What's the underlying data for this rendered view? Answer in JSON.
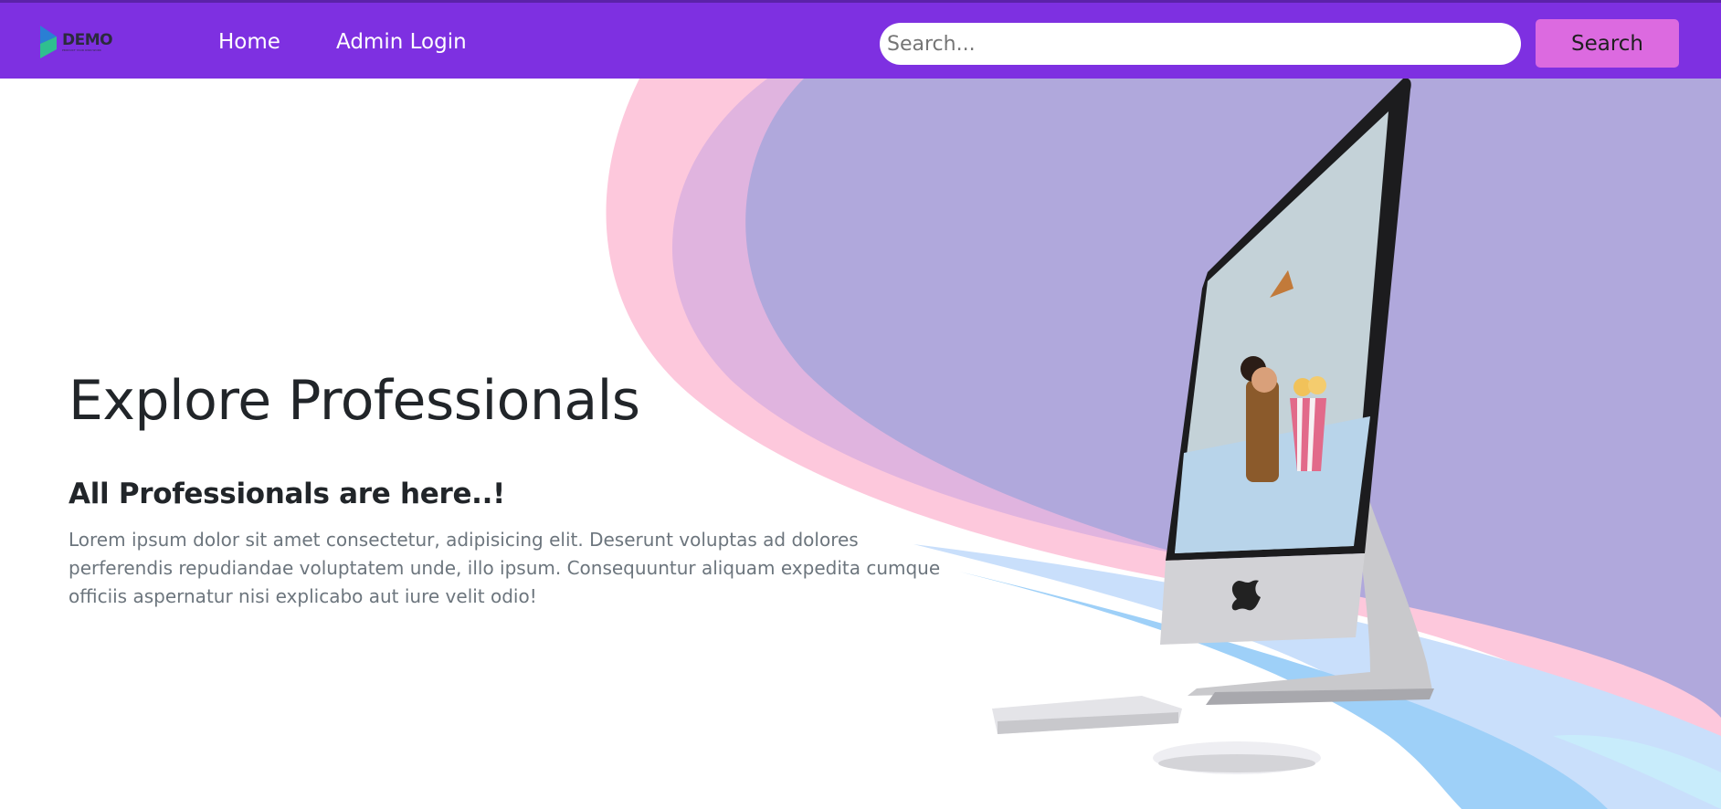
{
  "navbar": {
    "brand": {
      "name": "DEMO",
      "tagline": "PRODUCT YOUR OWN WORK"
    },
    "links": [
      {
        "label": "Home"
      },
      {
        "label": "Admin Login"
      }
    ],
    "search": {
      "placeholder": "Search...",
      "value": "",
      "button_label": "Search"
    },
    "colors": {
      "background": "#7e30e1",
      "search_button": "#dc6ae0"
    }
  },
  "hero": {
    "title": "Explore Professionals",
    "subtitle": "All Professionals are here..!",
    "description": "Lorem ipsum dolor sit amet consectetur, adipisicing elit. Deserunt voluptas ad dolores perferendis repudiandae voluptatem unde, illo ipsum. Consequuntur aliquam expedita cumque officiis aspernatur nisi explicabo aut iure velit odio!",
    "image": "imac-desktop-with-keyboard-and-mouse",
    "colors": {
      "wave_pink": "#fdc8dc",
      "wave_mauve": "#e0b4df",
      "wave_purple": "#b0a8dc",
      "wave_blue": "#9ed0f8"
    }
  }
}
